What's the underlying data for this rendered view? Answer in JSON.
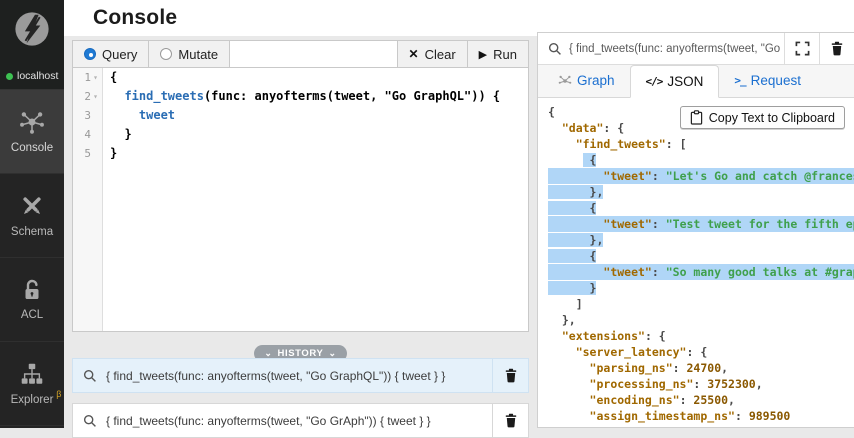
{
  "colors": {
    "accent_blue": "#1b6fd0",
    "radio_blue": "#1f7ad4",
    "selection_blue": "#b0d6f7",
    "history_highlight": "#e5f1fa",
    "status_green": "#3dc152",
    "beta_gold": "#d2a226",
    "json_key": "#a06800",
    "json_string": "#3fa04c",
    "json_number": "#8a5800",
    "code_field_blue": "#2a6db4"
  },
  "sidebar": {
    "logo_icon": "dgraph-bolt-logo",
    "server": {
      "label": "localhost",
      "status": "connected"
    },
    "items": [
      {
        "label": "Console",
        "icon": "graph-icon",
        "active": true,
        "badge": ""
      },
      {
        "label": "Schema",
        "icon": "schema-icon",
        "active": false,
        "badge": ""
      },
      {
        "label": "ACL",
        "icon": "lock-icon",
        "active": false,
        "badge": ""
      },
      {
        "label": "Explorer",
        "icon": "sitemap-icon",
        "active": false,
        "badge": "β"
      }
    ]
  },
  "header": {
    "title": "Console"
  },
  "query_panel": {
    "modes": [
      {
        "label": "Query",
        "selected": true
      },
      {
        "label": "Mutate",
        "selected": false
      }
    ],
    "clear_label": "Clear",
    "run_label": "Run",
    "editor_lines": [
      {
        "num": 1,
        "fold": true,
        "segs": [
          {
            "t": "plain",
            "v": "{"
          }
        ]
      },
      {
        "num": 2,
        "fold": true,
        "segs": [
          {
            "t": "plain",
            "v": "  "
          },
          {
            "t": "field",
            "v": "find_tweets"
          },
          {
            "t": "plain",
            "v": "(func: anyofterms(tweet, \"Go GraphQL\")) {"
          }
        ]
      },
      {
        "num": 3,
        "fold": false,
        "segs": [
          {
            "t": "plain",
            "v": "    "
          },
          {
            "t": "field",
            "v": "tweet"
          }
        ]
      },
      {
        "num": 4,
        "fold": false,
        "segs": [
          {
            "t": "plain",
            "v": "  }"
          }
        ]
      },
      {
        "num": 5,
        "fold": false,
        "segs": [
          {
            "t": "plain",
            "v": "}"
          }
        ]
      }
    ]
  },
  "history": {
    "label": "HISTORY",
    "items": [
      {
        "query": "{ find_tweets(func: anyofterms(tweet, \"Go GraphQL\")) { tweet } }",
        "highlighted": true
      },
      {
        "query": "{ find_tweets(func: anyofterms(tweet, \"Go GrAph\")) { tweet } }",
        "highlighted": false
      }
    ]
  },
  "result_panel": {
    "search_value": "{ find_tweets(func: anyofterms(tweet, \"Go ...",
    "tabs": [
      {
        "label": "Graph",
        "icon": "graph-small-icon",
        "active": false
      },
      {
        "label": "JSON",
        "icon": "code-icon",
        "active": true
      },
      {
        "label": "Request",
        "icon": "terminal-icon",
        "active": false
      }
    ],
    "copy_button_label": "Copy Text to Clipboard",
    "json_lines": [
      {
        "hl": "none",
        "segs": [
          {
            "t": "pun",
            "v": "{"
          }
        ]
      },
      {
        "hl": "none",
        "segs": [
          {
            "t": "pun",
            "v": "  "
          },
          {
            "t": "key",
            "v": "\"data\""
          },
          {
            "t": "pun",
            "v": ": {"
          }
        ]
      },
      {
        "hl": "none",
        "segs": [
          {
            "t": "pun",
            "v": "    "
          },
          {
            "t": "key",
            "v": "\"find_tweets\""
          },
          {
            "t": "pun",
            "v": ": ["
          }
        ]
      },
      {
        "hl": "seg",
        "segs": [
          {
            "t": "pun",
            "v": "     "
          },
          {
            "t": "pun",
            "v": " {",
            "hl": true
          }
        ]
      },
      {
        "hl": "full",
        "segs": [
          {
            "t": "pun",
            "v": "        "
          },
          {
            "t": "key",
            "v": "\"tweet\""
          },
          {
            "t": "pun",
            "v": ": "
          },
          {
            "t": "str",
            "v": "\"Let's Go and catch @francesc"
          }
        ]
      },
      {
        "hl": "seg",
        "segs": [
          {
            "t": "pun",
            "v": "      },",
            "hl": true
          }
        ]
      },
      {
        "hl": "seg",
        "segs": [
          {
            "t": "pun",
            "v": "      {",
            "hl": true
          }
        ]
      },
      {
        "hl": "full",
        "segs": [
          {
            "t": "pun",
            "v": "        "
          },
          {
            "t": "key",
            "v": "\"tweet\""
          },
          {
            "t": "pun",
            "v": ": "
          },
          {
            "t": "str",
            "v": "\"Test tweet for the fifth epis"
          }
        ]
      },
      {
        "hl": "seg",
        "segs": [
          {
            "t": "pun",
            "v": "      },",
            "hl": true
          }
        ]
      },
      {
        "hl": "seg",
        "segs": [
          {
            "t": "pun",
            "v": "      {",
            "hl": true
          }
        ]
      },
      {
        "hl": "full",
        "segs": [
          {
            "t": "pun",
            "v": "        "
          },
          {
            "t": "key",
            "v": "\"tweet\""
          },
          {
            "t": "pun",
            "v": ": "
          },
          {
            "t": "str",
            "v": "\"So many good talks at #grapho"
          }
        ]
      },
      {
        "hl": "seg",
        "segs": [
          {
            "t": "pun",
            "v": "      }",
            "hl": true
          }
        ]
      },
      {
        "hl": "none",
        "segs": [
          {
            "t": "pun",
            "v": "    ]"
          }
        ]
      },
      {
        "hl": "none",
        "segs": [
          {
            "t": "pun",
            "v": "  },"
          }
        ]
      },
      {
        "hl": "none",
        "segs": [
          {
            "t": "pun",
            "v": "  "
          },
          {
            "t": "key",
            "v": "\"extensions\""
          },
          {
            "t": "pun",
            "v": ": {"
          }
        ]
      },
      {
        "hl": "none",
        "segs": [
          {
            "t": "pun",
            "v": "    "
          },
          {
            "t": "key",
            "v": "\"server_latency\""
          },
          {
            "t": "pun",
            "v": ": {"
          }
        ]
      },
      {
        "hl": "none",
        "segs": [
          {
            "t": "pun",
            "v": "      "
          },
          {
            "t": "key",
            "v": "\"parsing_ns\""
          },
          {
            "t": "pun",
            "v": ": "
          },
          {
            "t": "num",
            "v": "24700"
          },
          {
            "t": "pun",
            "v": ","
          }
        ]
      },
      {
        "hl": "none",
        "segs": [
          {
            "t": "pun",
            "v": "      "
          },
          {
            "t": "key",
            "v": "\"processing_ns\""
          },
          {
            "t": "pun",
            "v": ": "
          },
          {
            "t": "num",
            "v": "3752300"
          },
          {
            "t": "pun",
            "v": ","
          }
        ]
      },
      {
        "hl": "none",
        "segs": [
          {
            "t": "pun",
            "v": "      "
          },
          {
            "t": "key",
            "v": "\"encoding_ns\""
          },
          {
            "t": "pun",
            "v": ": "
          },
          {
            "t": "num",
            "v": "25500"
          },
          {
            "t": "pun",
            "v": ","
          }
        ]
      },
      {
        "hl": "none",
        "segs": [
          {
            "t": "pun",
            "v": "      "
          },
          {
            "t": "key",
            "v": "\"assign_timestamp_ns\""
          },
          {
            "t": "pun",
            "v": ": "
          },
          {
            "t": "num",
            "v": "989500"
          }
        ]
      }
    ]
  }
}
